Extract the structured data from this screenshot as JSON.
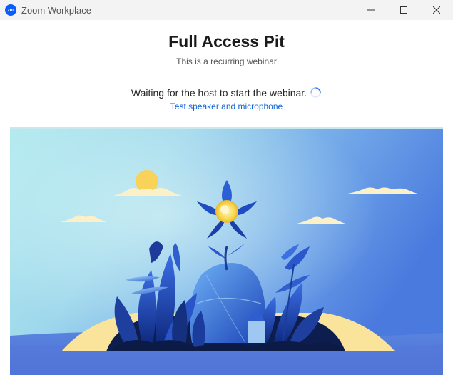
{
  "window": {
    "app_icon_text": "zm",
    "title": "Zoom Workplace",
    "controls": [
      "minimize-icon",
      "maximize-icon",
      "close-icon"
    ]
  },
  "meeting": {
    "title": "Full Access Pit",
    "subtitle": "This is a recurring webinar",
    "status": "Waiting for the host to start the webinar.",
    "test_link": "Test speaker and microphone"
  },
  "illustration": {
    "subject": "flower-garden-illustration",
    "colors": {
      "sky_light": "#a8e6ec",
      "sky_dark": "#4f7ddf",
      "sun": "#f9d25a",
      "ground": "#0e1e4f",
      "sand": "#fae39a"
    }
  },
  "colors": {
    "accent": "#0b5cff",
    "link": "#0e63d6"
  }
}
